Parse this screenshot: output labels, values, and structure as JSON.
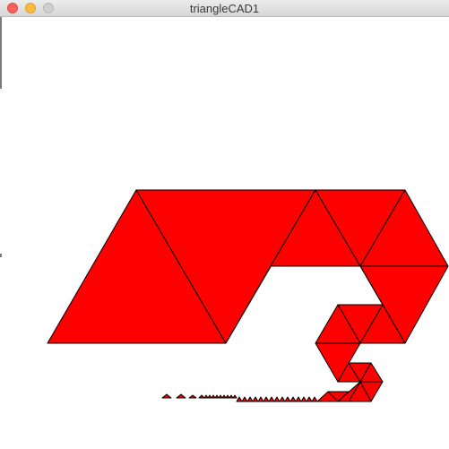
{
  "window": {
    "title": "triangleCAD1"
  },
  "colors": {
    "fill": "#ff0000",
    "stroke": "#000000",
    "background": "#ffffff"
  }
}
